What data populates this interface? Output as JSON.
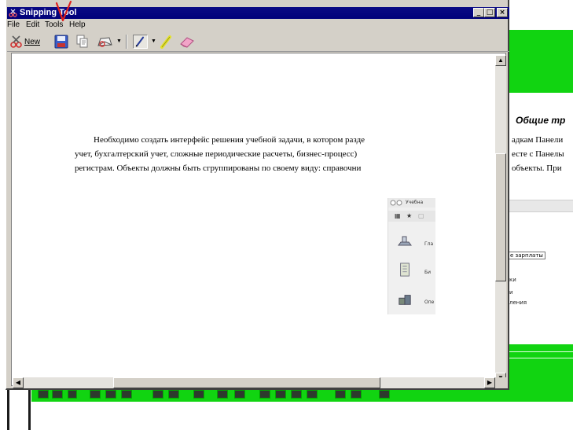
{
  "window": {
    "title": "Snipping Tool",
    "controls": {
      "minimize": "_",
      "maximize": "□",
      "close": "×"
    }
  },
  "menu": {
    "items": [
      "File",
      "Edit",
      "Tools",
      "Help"
    ]
  },
  "toolbar": {
    "new_label": "New",
    "icons": [
      "new-snip-icon",
      "save-icon",
      "copy-icon",
      "send-snip-icon",
      "pen-icon",
      "highlighter-icon",
      "eraser-icon"
    ]
  },
  "captured_document": {
    "lines": [
      "Необходимо создать интерфейс решения учебной задачи, в котором разде",
      "учет, бухгалтерский учет, сложные периодические расчеты, бизнес-процесс)",
      "регистрам. Объекты должны быть сгруппированы по своему виду: справочни"
    ],
    "embedded_window": {
      "title": "Учебна",
      "items": [
        "Гла",
        "Би",
        "Опе"
      ]
    }
  },
  "background_document": {
    "heading": "Общие тр",
    "lines": [
      "адкам Панели",
      "есте с Панелы",
      " объекты. При"
    ],
    "box_text": "е зарплаты",
    "small_lines": [
      "ки",
      "и",
      "ления"
    ]
  },
  "colors": {
    "title_bar": "#00007a",
    "window_face": "#d4d0c8",
    "background_green": "#11d411",
    "annotation": "#e0201c"
  }
}
